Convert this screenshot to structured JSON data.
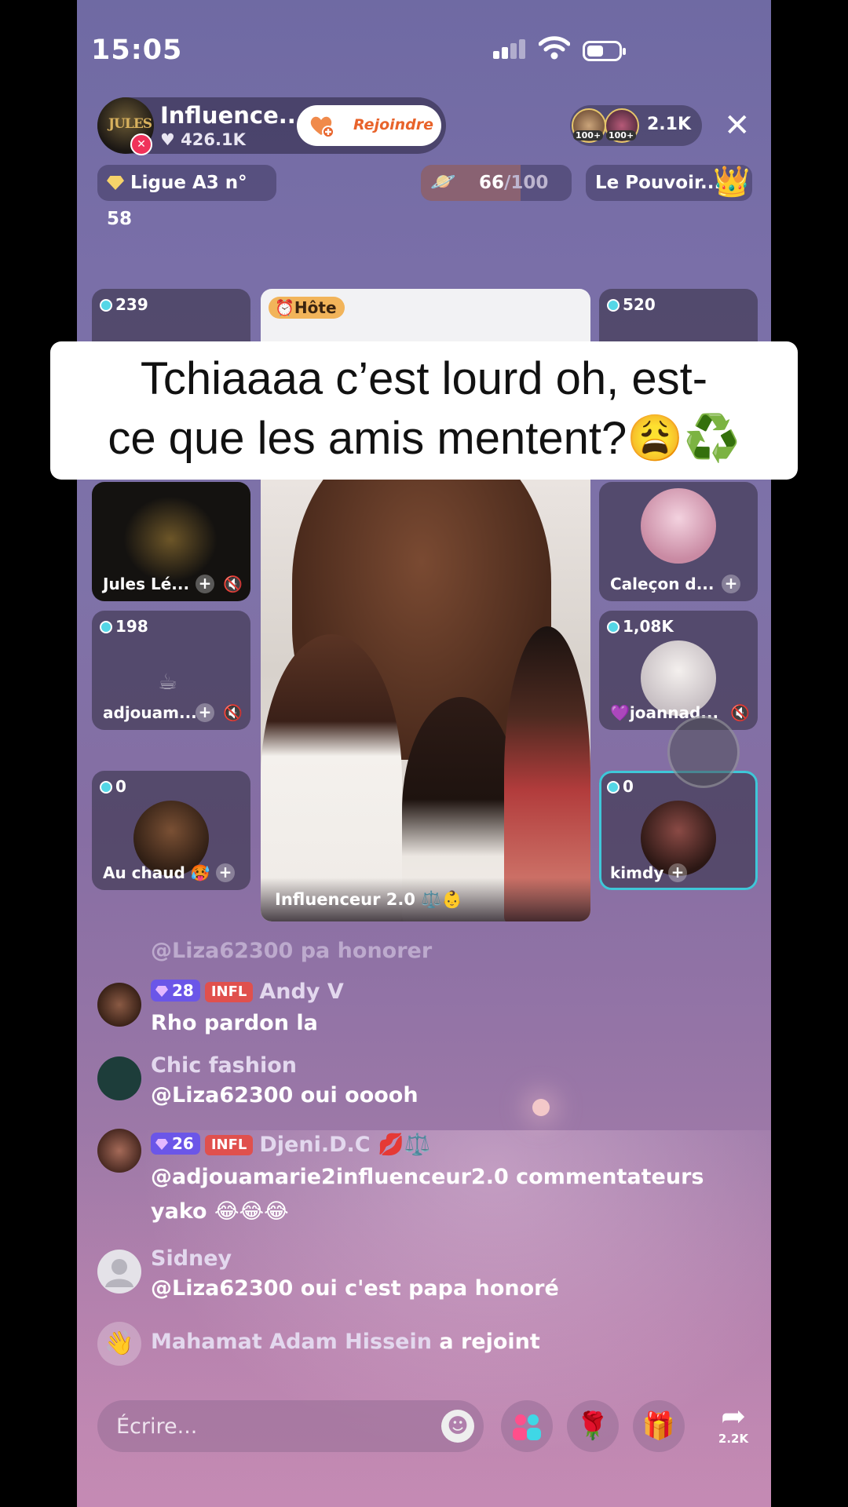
{
  "status": {
    "time": "15:05"
  },
  "host": {
    "name": "Influence...",
    "likes": "426.1K",
    "join_label": "Rejoindre",
    "avatar_text": "JULES"
  },
  "viewers": {
    "count": "2.1K",
    "badge1": "100+",
    "badge2": "100+"
  },
  "league": {
    "label": "Ligue A3 n° 58"
  },
  "goal": {
    "current": "66",
    "total": "/100",
    "progress": 0.66
  },
  "power": {
    "label": "Le Pouvoir..."
  },
  "grid": {
    "t1": {
      "score": "239"
    },
    "t2": {
      "name": "Jules Lé..."
    },
    "t3": {
      "score": "198",
      "name": "adjouam..."
    },
    "t4": {
      "score": "0",
      "name": "Au chaud 🥵"
    },
    "t5": {
      "score": "520"
    },
    "t6": {
      "name": "Caleçon d..."
    },
    "t7": {
      "score": "1,08K",
      "name": "💜joannad..."
    },
    "t8": {
      "score": "0",
      "name": "kimdy"
    }
  },
  "main_video": {
    "badge": "Hôte",
    "label": "Influenceur 2.0 ⚖️👶"
  },
  "caption": {
    "line1": "Tchiaaaa c’est lourd oh, est-",
    "line2": "ce que les amis mentent?😩♻️"
  },
  "chat": [
    {
      "text": "@Liza62300 pa honorer"
    },
    {
      "level": "28",
      "badge": "INFL",
      "user": "Andy V",
      "msg": "Rho pardon la"
    },
    {
      "user": "Chic fashion",
      "msg": "@Liza62300 oui ooooh"
    },
    {
      "level": "26",
      "badge": "INFL",
      "user": "Djeni.D.C 💋⚖️",
      "msg": "@adjouamarie2influenceur2.0 commentateurs",
      "msg2": "yako 😂😂😂"
    },
    {
      "user": "Sidney",
      "msg": "@Liza62300 oui c'est papa honoré"
    },
    {
      "user": "Mahamat Adam Hissein",
      "action": "a rejoint"
    }
  ],
  "bottom": {
    "placeholder": "Écrire...",
    "share_count": "2.2K"
  }
}
